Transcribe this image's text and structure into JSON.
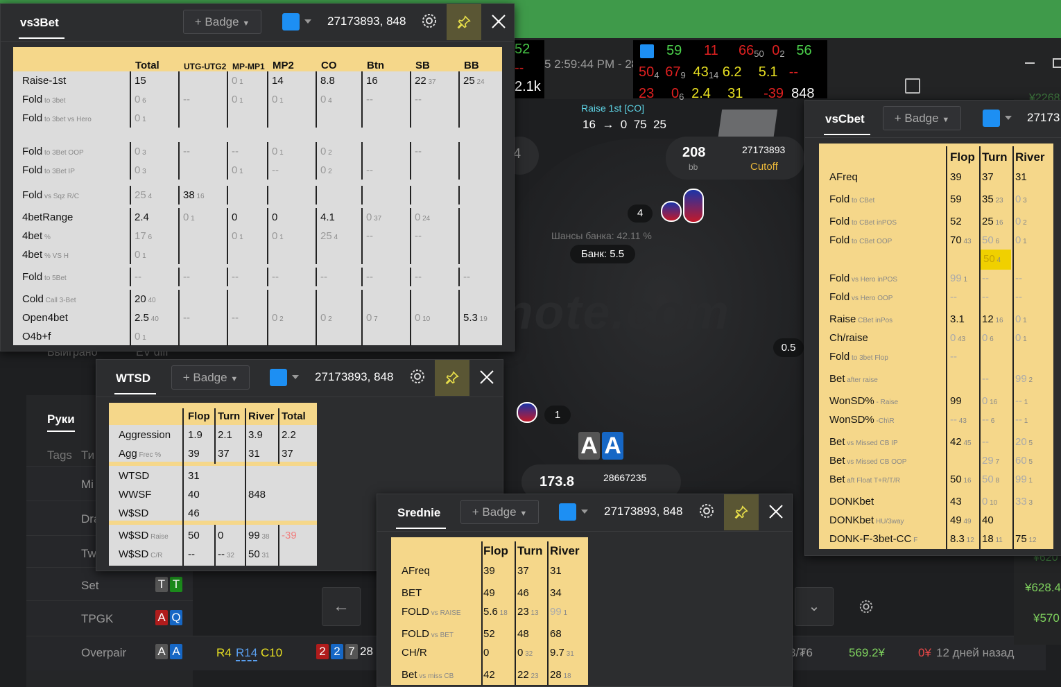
{
  "background": {
    "hud_stats": {
      "row1": [
        "59",
        "11",
        "66",
        "50",
        "0",
        "2",
        "56"
      ],
      "row2": [
        "50",
        "4",
        "67",
        "9",
        "43",
        "14",
        "6.2",
        "5.1",
        "--"
      ],
      "row3": [
        "23",
        "0",
        "6",
        "2.4",
        "31",
        "-39",
        "848"
      ]
    },
    "top_left": {
      "v1": "52",
      "v2": "--",
      "v3": "2.1k"
    },
    "time_text": "5 2:59:44 PM - 28",
    "raise_label": "Raise 1st  [CO]",
    "raise_values": "16  →  0  75  25",
    "seat_cutoff": {
      "stack": "208",
      "unit": "bb",
      "id": "27173893",
      "pos": "Cutoff"
    },
    "seat_left_num": "4",
    "pot_chips_count": "4",
    "pot_equity": "Шансы банка: 42.11 %",
    "pot_bank": "Банк: 5.5",
    "bet_right": "0.5",
    "hero_bet": "1",
    "hero_cards": [
      "A",
      "A"
    ],
    "hero_seat": {
      "stack": "173.8",
      "id": "28667235"
    },
    "watermark": "d2note.com",
    "left_tabs": {
      "hands": "Руки",
      "tags": "Tags",
      "ti": "Ти"
    },
    "header_cols": {
      "won": "Выиграно",
      "ev": "EV diff"
    },
    "partial_labels": [
      "Mi",
      "Dra",
      "Tw"
    ],
    "rows": [
      {
        "label": "Set",
        "cards": [
          "T",
          "T"
        ]
      },
      {
        "label": "TPGK",
        "cards": [
          "A",
          "Q"
        ]
      },
      {
        "label": "Overpair",
        "cards": [
          "A",
          "A"
        ]
      }
    ],
    "overpair_line": {
      "r4": "R4",
      "r14": "R14",
      "c10": "C10",
      "board": [
        "2",
        "2",
        "7"
      ],
      "board_more": "28",
      "stake": "3/₮6",
      "won": "569.2¥",
      "ev": "0¥",
      "time": "12 дней назад"
    },
    "right_values": [
      "¥2268",
      "¥620",
      "¥628.4",
      "¥570"
    ]
  },
  "panels": {
    "vs3bet": {
      "title": "vs3Bet",
      "badge": "+ Badge",
      "player": "27173893, 848",
      "headers": [
        "Total",
        "UTG-UTG2",
        "MP-MP1",
        "MP2",
        "CO",
        "Btn",
        "SB",
        "BB"
      ],
      "rows": [
        [
          "Raise-1st",
          "15",
          "",
          "0 1",
          "14",
          "8.8",
          "16",
          "22 37",
          "25 24",
          ""
        ],
        [
          "Fold to 3bet",
          "0 6",
          "--",
          "0 1",
          "0 1",
          "0 4",
          "--",
          "--",
          ""
        ],
        [
          "Fold to 3bet vs Hero",
          "0 1"
        ],
        [
          "Fold to 3Bet OOP",
          "0 3",
          "--",
          "--",
          "0 1",
          "0 2",
          "",
          "--",
          ""
        ],
        [
          "Fold to 3Bet IP",
          "0 3",
          "",
          "0 1",
          "--",
          "0 2",
          "--",
          "",
          ""
        ],
        [
          "Fold vs Sqz R/C",
          "25 4",
          "38 16"
        ],
        [
          "4betRange",
          "2.4",
          "0 1",
          "0",
          "0",
          "4.1",
          "0 37",
          "0 24",
          ""
        ],
        [
          "4bet %",
          "17 6",
          "",
          "0 1",
          "0 1",
          "25 4",
          "--",
          "--",
          ""
        ],
        [
          "4bet % VS H",
          "0 1"
        ],
        [
          "Fold to 5Bet",
          "--",
          "--",
          "--",
          "--",
          "--",
          "--",
          "--",
          "--"
        ],
        [
          "Cold Call 3-Bet",
          "20 40"
        ],
        [
          "Open4bet",
          "2.5 40",
          "--",
          "--",
          "0 2",
          "0 2",
          "0 7",
          "0 10",
          "5.3 19"
        ],
        [
          "O4b+f",
          "0 1"
        ]
      ]
    },
    "wtsd": {
      "title": "WTSD",
      "badge": "+ Badge",
      "player": "27173893, 848",
      "headers": [
        "Flop",
        "Turn",
        "River",
        "Total"
      ],
      "r1": [
        [
          "Aggression",
          "1.9",
          "2.1",
          "3.9",
          "2.2"
        ],
        [
          "Agg Frec %",
          "39",
          "37",
          "31",
          "37"
        ]
      ],
      "r2": {
        "wtsd": [
          "WTSD",
          "31"
        ],
        "wwsf": [
          "WWSF",
          "40",
          "848"
        ],
        "wsd": [
          "W$SD",
          "46"
        ]
      },
      "r3": [
        [
          "W$SD Raise",
          "50",
          "0",
          "99 38",
          "-39"
        ],
        [
          "W$SD C/R",
          "--",
          "-- 32",
          "50 31",
          ""
        ]
      ]
    },
    "srednie": {
      "title": "Srednie",
      "badge": "+ Badge",
      "player": "27173893, 848",
      "headers": [
        "Flop",
        "Turn",
        "River"
      ],
      "rows": [
        [
          "AFreq",
          "39",
          "37",
          "31"
        ],
        [
          "BET",
          "49",
          "46",
          "34"
        ],
        [
          "FOLD vs RAISE",
          "5.6 18",
          "23 13",
          "99 1"
        ],
        [
          "FOLD vs BET",
          "52",
          "48",
          "68"
        ],
        [
          "CH/R",
          "0",
          "0 32",
          "9.7 31"
        ],
        [
          "Bet vs miss CB",
          "42",
          "22 23",
          "28 18"
        ]
      ]
    },
    "vscbet": {
      "title": "vsCbet",
      "badge": "+ Badge",
      "player": "27173",
      "headers": [
        "Flop",
        "Turn",
        "River"
      ],
      "rows": [
        [
          "AFreq",
          "39",
          "37",
          "31"
        ],
        [
          "Fold to CBet",
          "59",
          "35 23",
          "0 3"
        ],
        [
          "Fold to CBet inPOS",
          "52",
          "25 16",
          "0 2"
        ],
        [
          "Fold to CBet OOP",
          "70 43",
          "50 6",
          "0 1"
        ],
        [
          "",
          "",
          "50 4",
          ""
        ],
        [
          "Fold vs Hero inPOS",
          "99 1",
          "--",
          "--"
        ],
        [
          "Fold vs Hero OOP",
          "--",
          "--",
          "--"
        ],
        [
          "Raise CBet inPos",
          "3.1",
          "12 16",
          "0 1"
        ],
        [
          "Ch/raise",
          "0 43",
          "0 6",
          "0 1"
        ],
        [
          "Fold to 3bet Flop",
          "--",
          "",
          ""
        ],
        [
          "Bet after raise",
          "",
          "--",
          "99 2"
        ],
        [
          "WonSD% - Raise",
          "99",
          "0 16",
          "-- 1"
        ],
        [
          "WonSD% -Ch\\R",
          "-- 43",
          "-- 6",
          "-- 1"
        ],
        [
          "Bet vs Missed CB IP",
          "42 45",
          "--",
          "20 5"
        ],
        [
          "Bet vs Missed CB OOP",
          "",
          "29 7",
          "60 5"
        ],
        [
          "Bet aft Float T+R/T/R",
          "50 16",
          "50 8",
          "99 1"
        ],
        [
          "DONKbet",
          "43",
          "0 10",
          "33 3"
        ],
        [
          "DONKbet HU/3way",
          "49 49",
          "40",
          ""
        ],
        [
          "DONK-F-3bet-CC F",
          "8.3 12",
          "18 11",
          "75 12"
        ]
      ]
    }
  }
}
